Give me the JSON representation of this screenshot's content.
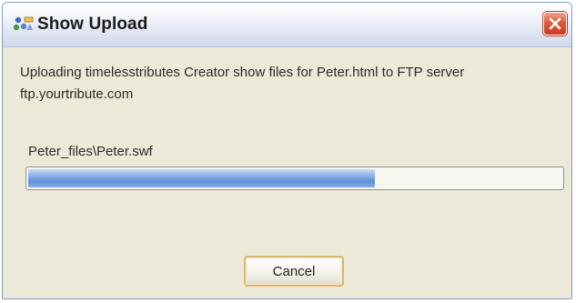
{
  "window": {
    "title": "Show Upload",
    "title_icon": "upload-app-icon",
    "close_icon": "close-icon",
    "close_color": "#d9462a"
  },
  "dialog": {
    "message": "Uploading timelesstributes Creator show files for Peter.html to FTP server ftp.yourtribute.com",
    "current_file": "Peter_files\\Peter.swf",
    "progress_fraction": 0.65,
    "progress_color": "#6f9ad9",
    "cancel_label": "Cancel"
  }
}
